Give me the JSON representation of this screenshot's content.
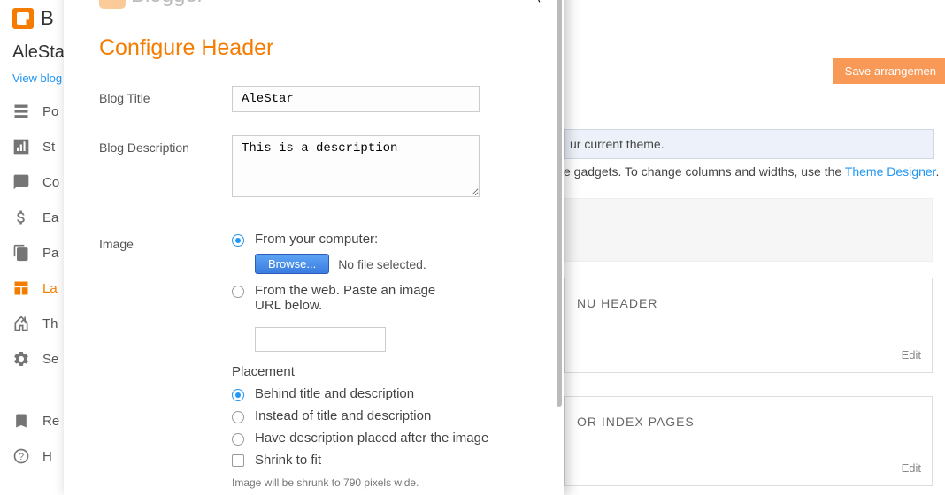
{
  "header": {
    "logo_text": "B",
    "blogger_text": "Blogger"
  },
  "sidebar": {
    "blog_name": "AleStar",
    "view_blog": "View blog",
    "items": [
      {
        "label": "Po",
        "icon": "posts",
        "active": false
      },
      {
        "label": "St",
        "icon": "stats",
        "active": false
      },
      {
        "label": "Co",
        "icon": "comments",
        "active": false
      },
      {
        "label": "Ea",
        "icon": "earnings",
        "active": false
      },
      {
        "label": "Pa",
        "icon": "pages",
        "active": false
      },
      {
        "label": "La",
        "icon": "layout",
        "active": true
      },
      {
        "label": "Th",
        "icon": "theme",
        "active": false
      },
      {
        "label": "Se",
        "icon": "settings",
        "active": false
      },
      {
        "label": "Re",
        "icon": "reading",
        "active": false
      },
      {
        "label": "H",
        "icon": "help",
        "active": false
      }
    ]
  },
  "modal": {
    "title": "Configure Header",
    "blog_title_label": "Blog Title",
    "blog_title_value": "AleStar",
    "blog_desc_label": "Blog Description",
    "blog_desc_value": "This is a description",
    "image_label": "Image",
    "from_computer": "From your computer:",
    "browse": "Browse...",
    "no_file": "No file selected.",
    "from_web": "From the web. Paste an image URL below.",
    "placement": "Placement",
    "placement_opts": [
      "Behind title and description",
      "Instead of title and description",
      "Have description placed after the image"
    ],
    "shrink": "Shrink to fit",
    "shrink_hint": "Image will be shrunk to 790 pixels wide."
  },
  "bg": {
    "save": "Save arrangemen",
    "info1": "ur current theme.",
    "info2a": "e gadgets. To change columns and widths, use the ",
    "info2b": "Theme Designer",
    "gadget1": "NU HEADER",
    "gadget2": "OR INDEX PAGES",
    "edit": "Edit"
  }
}
